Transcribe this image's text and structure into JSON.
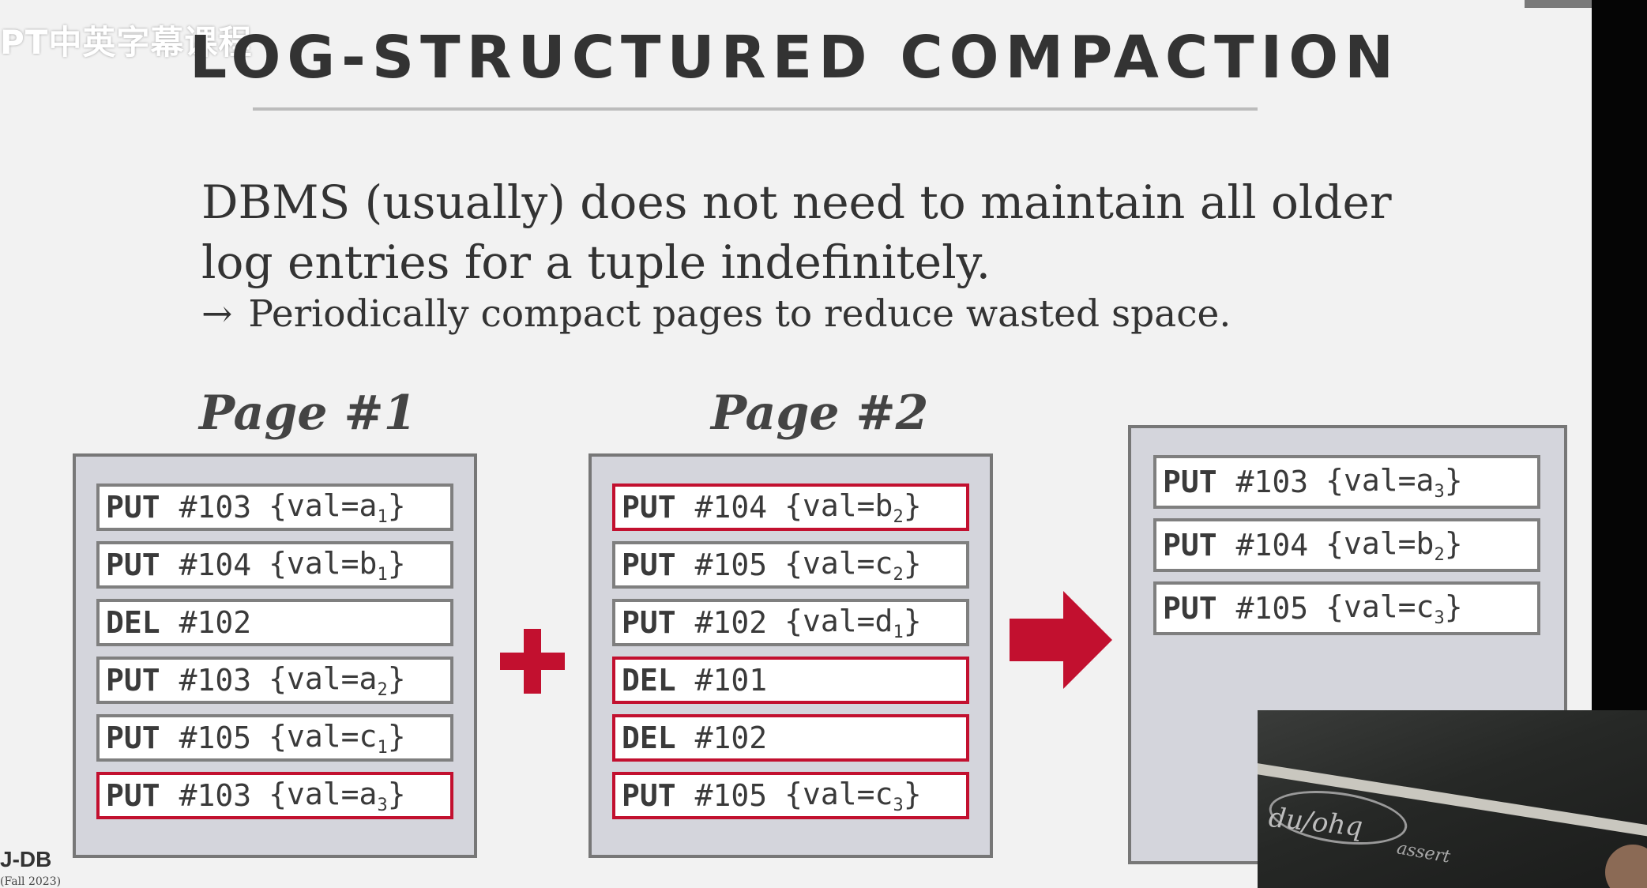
{
  "watermark": "PT中英字幕课程",
  "slide": {
    "title": "LOG-STRUCTURED COMPACTION",
    "body": "DBMS (usually) does not need to maintain all older log entries for a tuple indefinitely.",
    "sub_bullet_arrow": "→",
    "sub_bullet": "Periodically compact pages to reduce wasted space.",
    "page1_label": "Page #1",
    "page2_label": "Page #2"
  },
  "page1": [
    {
      "op": "PUT",
      "key": "#103",
      "pre": "{val=a",
      "sub": "1",
      "post": "}",
      "highlight": false
    },
    {
      "op": "PUT",
      "key": "#104",
      "pre": "{val=b",
      "sub": "1",
      "post": "}",
      "highlight": false
    },
    {
      "op": "DEL",
      "key": "#102",
      "pre": "",
      "sub": "",
      "post": "",
      "highlight": false
    },
    {
      "op": "PUT",
      "key": "#103",
      "pre": "{val=a",
      "sub": "2",
      "post": "}",
      "highlight": false
    },
    {
      "op": "PUT",
      "key": "#105",
      "pre": "{val=c",
      "sub": "1",
      "post": "}",
      "highlight": false
    },
    {
      "op": "PUT",
      "key": "#103",
      "pre": "{val=a",
      "sub": "3",
      "post": "}",
      "highlight": true
    }
  ],
  "page2": [
    {
      "op": "PUT",
      "key": "#104",
      "pre": "{val=b",
      "sub": "2",
      "post": "}",
      "highlight": true
    },
    {
      "op": "PUT",
      "key": "#105",
      "pre": "{val=c",
      "sub": "2",
      "post": "}",
      "highlight": false
    },
    {
      "op": "PUT",
      "key": "#102",
      "pre": "{val=d",
      "sub": "1",
      "post": "}",
      "highlight": false
    },
    {
      "op": "DEL",
      "key": "#101",
      "pre": "",
      "sub": "",
      "post": "",
      "highlight": true
    },
    {
      "op": "DEL",
      "key": "#102",
      "pre": "",
      "sub": "",
      "post": "",
      "highlight": true
    },
    {
      "op": "PUT",
      "key": "#105",
      "pre": "{val=c",
      "sub": "3",
      "post": "}",
      "highlight": true
    }
  ],
  "result": [
    {
      "op": "PUT",
      "key": "#103",
      "pre": "{val=a",
      "sub": "3",
      "post": "}",
      "highlight": false
    },
    {
      "op": "PUT",
      "key": "#104",
      "pre": "{val=b",
      "sub": "2",
      "post": "}",
      "highlight": false
    },
    {
      "op": "PUT",
      "key": "#105",
      "pre": "{val=c",
      "sub": "3",
      "post": "}",
      "highlight": false
    }
  ],
  "footer": {
    "logo": "J-DB",
    "course": "(Fall 2023)"
  },
  "webcam": {
    "chalk_main": "du/ohq",
    "chalk_small": "assert"
  },
  "colors": {
    "highlight": "#c2102f",
    "box_fill": "#d4d5dc",
    "text": "#333333"
  }
}
